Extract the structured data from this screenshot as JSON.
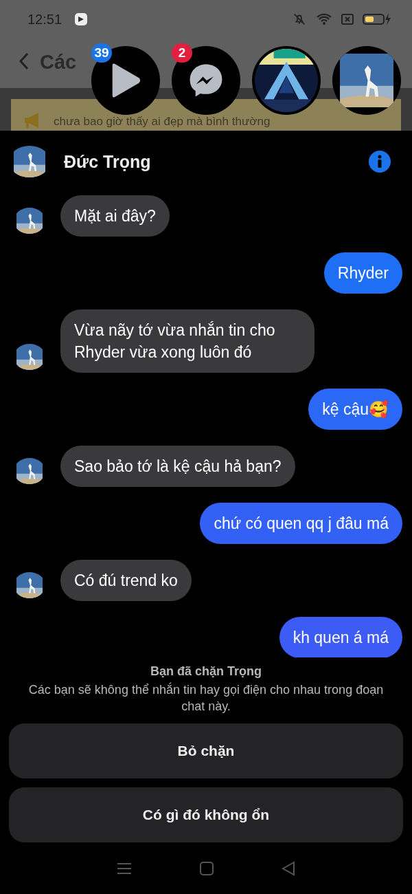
{
  "status_bar": {
    "time": "12:51"
  },
  "background": {
    "title_fragments": [
      "Các"
    ],
    "banner": "chưa bao giờ thấy ai đẹp mà bình thường"
  },
  "chat_heads": [
    {
      "kind": "video",
      "badge": "39",
      "color": "#1a73e8",
      "selected": false
    },
    {
      "kind": "messenger",
      "badge": "2",
      "color": "#e41e3f",
      "selected": false
    },
    {
      "kind": "picture",
      "selected": false
    },
    {
      "kind": "picture",
      "selected": true
    }
  ],
  "chat": {
    "name": "Đức Trọng",
    "messages": [
      {
        "kind": "incoming",
        "text": "Mặt ai đây?"
      },
      {
        "kind": "outgoing",
        "text": "Rhyder",
        "color": "#1e6ff5"
      },
      {
        "kind": "incoming",
        "text": "Vừa nãy tớ vừa nhắn tin cho Rhyder vừa xong luôn đó"
      },
      {
        "kind": "outgoing",
        "text": "kệ cậu🥰",
        "color": "#2a68f5"
      },
      {
        "kind": "incoming",
        "text": "Sao bảo tớ là kệ cậu hả bạn?"
      },
      {
        "kind": "outgoing",
        "text": "chứ có quen qq j đâu má",
        "color": "#3461f5"
      },
      {
        "kind": "incoming",
        "text": "Có đú trend ko"
      },
      {
        "kind": "outgoing",
        "text": "kh quen á má",
        "color": "#3d5bf5"
      }
    ],
    "block_notice": {
      "title": "Bạn đã chặn Trọng",
      "body": "Các bạn sẽ không thể nhắn tin hay gọi điện cho nhau trong đoạn chat này."
    },
    "buttons": [
      "Bỏ chặn",
      "Có gì đó không ổn"
    ]
  }
}
